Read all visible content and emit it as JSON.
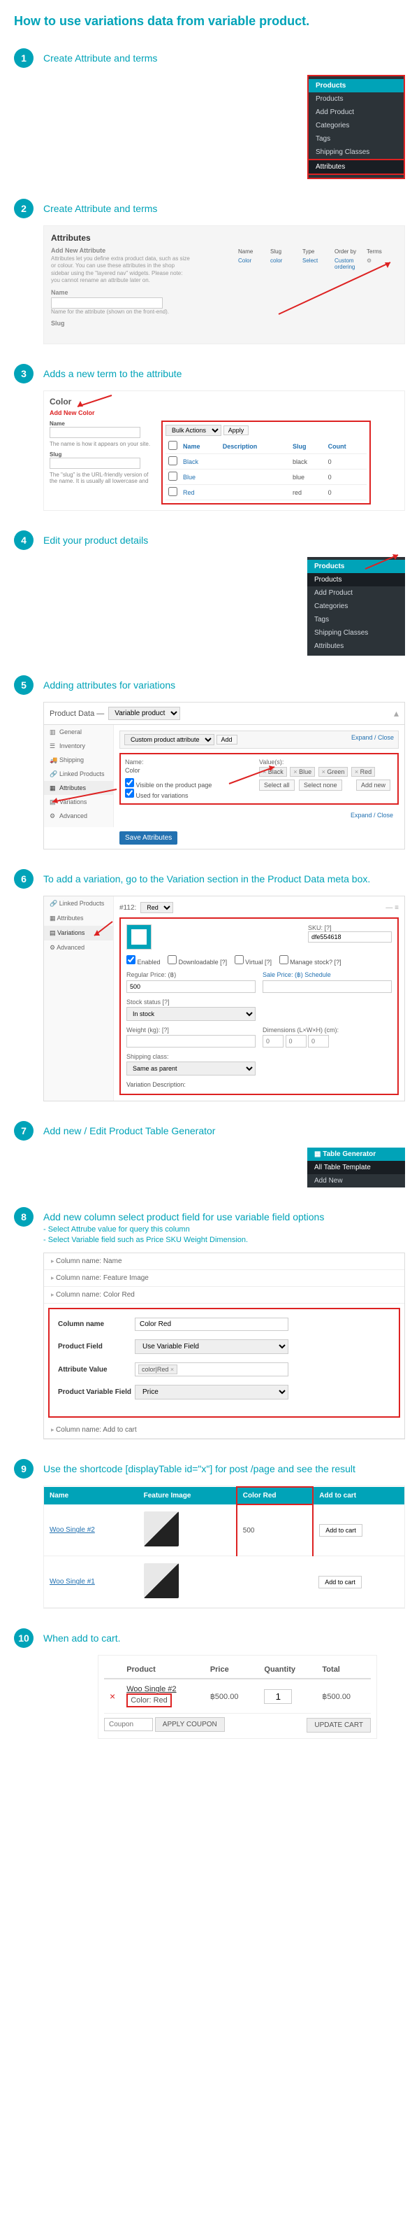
{
  "title": "How to use variations data from variable product.",
  "steps": {
    "1": {
      "text": "Create Attribute and terms"
    },
    "2": {
      "text": "Create Attribute and terms"
    },
    "3": {
      "text": "Adds a new term to the attribute"
    },
    "4": {
      "text": "Edit your product details"
    },
    "5": {
      "text": "Adding attributes for variations"
    },
    "6": {
      "text": "To add a variation, go to the Variation section in the Product Data meta box."
    },
    "7": {
      "text": "Add new / Edit Product Table Generator"
    },
    "8": {
      "text": "Add new column select product field for use variable field options",
      "sub1": "- Select Attrube value for query this column",
      "sub2": "- Select Variable field such as Price SKU Weight Dimension."
    },
    "9": {
      "text": "Use the shortcode [displayTable id=\"x\"] for post /page and see the result"
    },
    "10": {
      "text": "When add to cart."
    }
  },
  "wp_menu": {
    "header": "Products",
    "items": [
      "Products",
      "Add Product",
      "Categories",
      "Tags",
      "Shipping Classes",
      "Attributes"
    ]
  },
  "wp_menu2": {
    "header": "Products",
    "items": [
      "Products",
      "Add Product",
      "Categories",
      "Tags",
      "Shipping Classes",
      "Attributes"
    ]
  },
  "attributes_panel": {
    "title": "Attributes",
    "add_title": "Add New Attribute",
    "desc": "Attributes let you define extra product data, such as size or colour. You can use these attributes in the shop sidebar using the \"layered nav\" widgets. Please note: you cannot rename an attribute later on.",
    "name_label": "Name",
    "slug_desc": "Name for the attribute (shown on the front-end).",
    "slug_label": "Slug",
    "table": {
      "headers": [
        "Name",
        "Slug",
        "Type",
        "Order by",
        "Terms"
      ],
      "row": [
        "Color",
        "color",
        "Select",
        "Custom ordering",
        ""
      ]
    }
  },
  "color_panel": {
    "title": "Color",
    "add": "Add New Color",
    "name_lbl": "Name",
    "name_desc": "The name is how it appears on your site.",
    "slug_lbl": "Slug",
    "slug_desc": "The \"slug\" is the URL-friendly version of the name. It is usually all lowercase and",
    "bulk_label": "Bulk Actions",
    "apply": "Apply",
    "headers": [
      "",
      "Name",
      "Description",
      "Slug",
      "Count"
    ],
    "rows": [
      [
        "",
        "Black",
        "",
        "black",
        "0"
      ],
      [
        "",
        "Blue",
        "",
        "blue",
        "0"
      ],
      [
        "",
        "Red",
        "",
        "red",
        "0"
      ]
    ]
  },
  "product_data": {
    "title": "Product Data —",
    "type": "Variable product",
    "side": [
      "General",
      "Inventory",
      "Shipping",
      "Linked Products",
      "Attributes",
      "Variations",
      "Advanced"
    ],
    "custom": "Custom product attribute",
    "add": "Add",
    "expand": "Expand / Close",
    "attr_name_lbl": "Name:",
    "attr_name_val": "Color",
    "cb1": "Visible on the product page",
    "cb2": "Used for variations",
    "values_lbl": "Value(s):",
    "values": [
      "Black",
      "Blue",
      "Green",
      "Red"
    ],
    "select_all": "Select all",
    "select_none": "Select none",
    "add_new": "Add new",
    "save": "Save Attributes"
  },
  "variation": {
    "side": [
      "Linked Products",
      "Attributes",
      "Variations",
      "Advanced"
    ],
    "num": "#112:",
    "sel": "Red",
    "sku_lbl": "SKU: [?]",
    "sku_val": "dfe554618",
    "enabled": "Enabled",
    "download": "Downloadable [?]",
    "virtual": "Virtual [?]",
    "stock": "Manage stock? [?]",
    "reg_price_lbl": "Regular Price: (฿)",
    "reg_price_val": "500",
    "sale_price_lbl": "Sale Price: (฿) Schedule",
    "stock_status_lbl": "Stock status [?]",
    "stock_status_val": "In stock",
    "weight_lbl": "Weight (kg): [?]",
    "dims_lbl": "Dimensions (L×W×H) (cm):",
    "dim_ph": "0",
    "ship_lbl": "Shipping class:",
    "ship_val": "Same as parent",
    "var_desc": "Variation Description:"
  },
  "tg_menu": {
    "header": "Table Generator",
    "items": [
      "All Table Template",
      "Add New"
    ]
  },
  "accordion": {
    "items": [
      "Column name: Name",
      "Column name: Feature Image",
      "Column name: Color Red",
      "Column name: Add to cart"
    ],
    "form": {
      "col_name_lbl": "Column name",
      "col_name_val": "Color Red",
      "pf_lbl": "Product Field",
      "pf_val": "Use Variable Field",
      "av_lbl": "Attribute Value",
      "av_val": "color|Red",
      "pvf_lbl": "Product Variable Field",
      "pvf_val": "Price"
    }
  },
  "result": {
    "headers": [
      "Name",
      "Feature Image",
      "Color Red",
      "Add to cart"
    ],
    "rows": [
      {
        "name": "Woo Single #2",
        "price": "500",
        "btn": "Add to cart"
      },
      {
        "name": "Woo Single #1",
        "price": "",
        "btn": "Add to cart"
      }
    ]
  },
  "cart": {
    "headers": [
      "",
      "Product",
      "Price",
      "Quantity",
      "Total"
    ],
    "row": {
      "name": "Woo Single #2",
      "attr": "Color: Red",
      "price": "฿500.00",
      "qty": "1",
      "total": "฿500.00"
    },
    "coupon": "Coupon",
    "apply": "APPLY COUPON",
    "update": "UPDATE CART"
  }
}
